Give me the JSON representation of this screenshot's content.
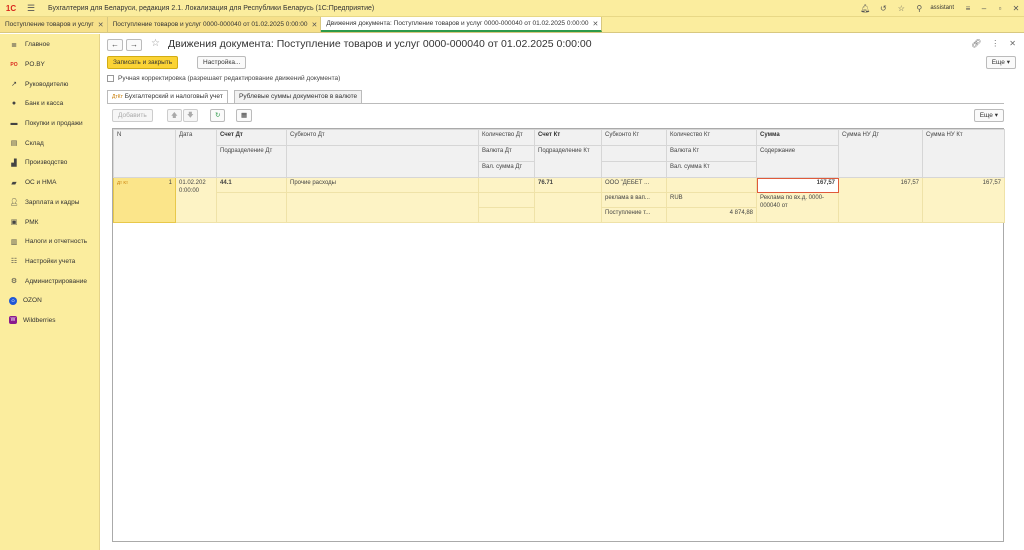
{
  "app": {
    "logo": "1С",
    "title": "Бухгалтерия для Беларуси, редакция 2.1. Локализация для Республики Беларусь   (1С:Предприятие)",
    "user": "assistant"
  },
  "window_tabs": [
    {
      "label": "Поступление товаров и услуг"
    },
    {
      "label": "Поступление товаров и услуг 0000-000040 от 01.02.2025 0:00:00"
    },
    {
      "label": "Движения документа: Поступление товаров и услуг 0000-000040 от 01.02.2025 0:00:00"
    }
  ],
  "sidebar": {
    "items": [
      {
        "label": "Главное",
        "icon": "menu-lines-icon"
      },
      {
        "label": "PO.BY",
        "icon": "po-by-icon"
      },
      {
        "label": "Руководителю",
        "icon": "trend-icon"
      },
      {
        "label": "Банк и касса",
        "icon": "coin-icon"
      },
      {
        "label": "Покупки и продажи",
        "icon": "cart-icon"
      },
      {
        "label": "Склад",
        "icon": "warehouse-icon"
      },
      {
        "label": "Производство",
        "icon": "factory-icon"
      },
      {
        "label": "ОС и НМА",
        "icon": "truck-icon"
      },
      {
        "label": "Зарплата и кадры",
        "icon": "people-icon"
      },
      {
        "label": "РМК",
        "icon": "register-icon"
      },
      {
        "label": "Налоги и отчетность",
        "icon": "tax-icon"
      },
      {
        "label": "Настройки учета",
        "icon": "settings-list-icon"
      },
      {
        "label": "Администрирование",
        "icon": "gear-icon"
      },
      {
        "label": "OZON",
        "icon": "ozon-icon"
      },
      {
        "label": "Wildberries",
        "icon": "wildberries-icon"
      }
    ]
  },
  "form": {
    "title": "Движения документа: Поступление товаров и услуг 0000-000040 от 01.02.2025 0:00:00",
    "save_close": "Записать и закрыть",
    "settings": "Настройка...",
    "more": "Еще",
    "manual_label": "Ручная корректировка (разрешает редактирование движений документа)",
    "tabs": [
      "Бухгалтерский и налоговый учет",
      "Рублевые суммы документов в валюте"
    ],
    "add": "Добавить",
    "grid_more": "Еще"
  },
  "grid": {
    "headers": {
      "n": "N",
      "date": "Дата",
      "acc_dt": "Счет Дт",
      "subdiv_dt": "Подразделение Дт",
      "subconto_dt": "Субконто Дт",
      "qty_dt": "Количество Дт",
      "cur_dt": "Валюта Дт",
      "cur_sum_dt": "Вал. сумма Дт",
      "acc_kt": "Счет Кт",
      "subdiv_kt": "Подразделение Кт",
      "subconto_kt": "Субконто Кт",
      "qty_kt": "Количество Кт",
      "cur_kt": "Валюта Кт",
      "cur_sum_kt": "Вал. сумма Кт",
      "sum": "Сумма",
      "content": "Содержание",
      "sum_nu_dt": "Сумма НУ Дт",
      "sum_nu_kt": "Сумма НУ Кт"
    },
    "rows": [
      {
        "icon": "Дт Кт",
        "n": "1",
        "date": "01.02.202 0:00:00",
        "acc_dt": "44.1",
        "subconto_dt_1": "Прочие расходы",
        "acc_kt": "76.71",
        "subconto_kt_1": "ООО \"ДЕБЕТ ...",
        "subconto_kt_2": "реклама в вап...",
        "subconto_kt_3": "Поступление т...",
        "cur_kt": "RUB",
        "cur_sum_kt": "4 874,88",
        "sum": "167,57",
        "content": "Реклама по вх.д. 0000-000040 от",
        "sum_nu_dt": "167,57",
        "sum_nu_kt": "167,57"
      }
    ]
  }
}
